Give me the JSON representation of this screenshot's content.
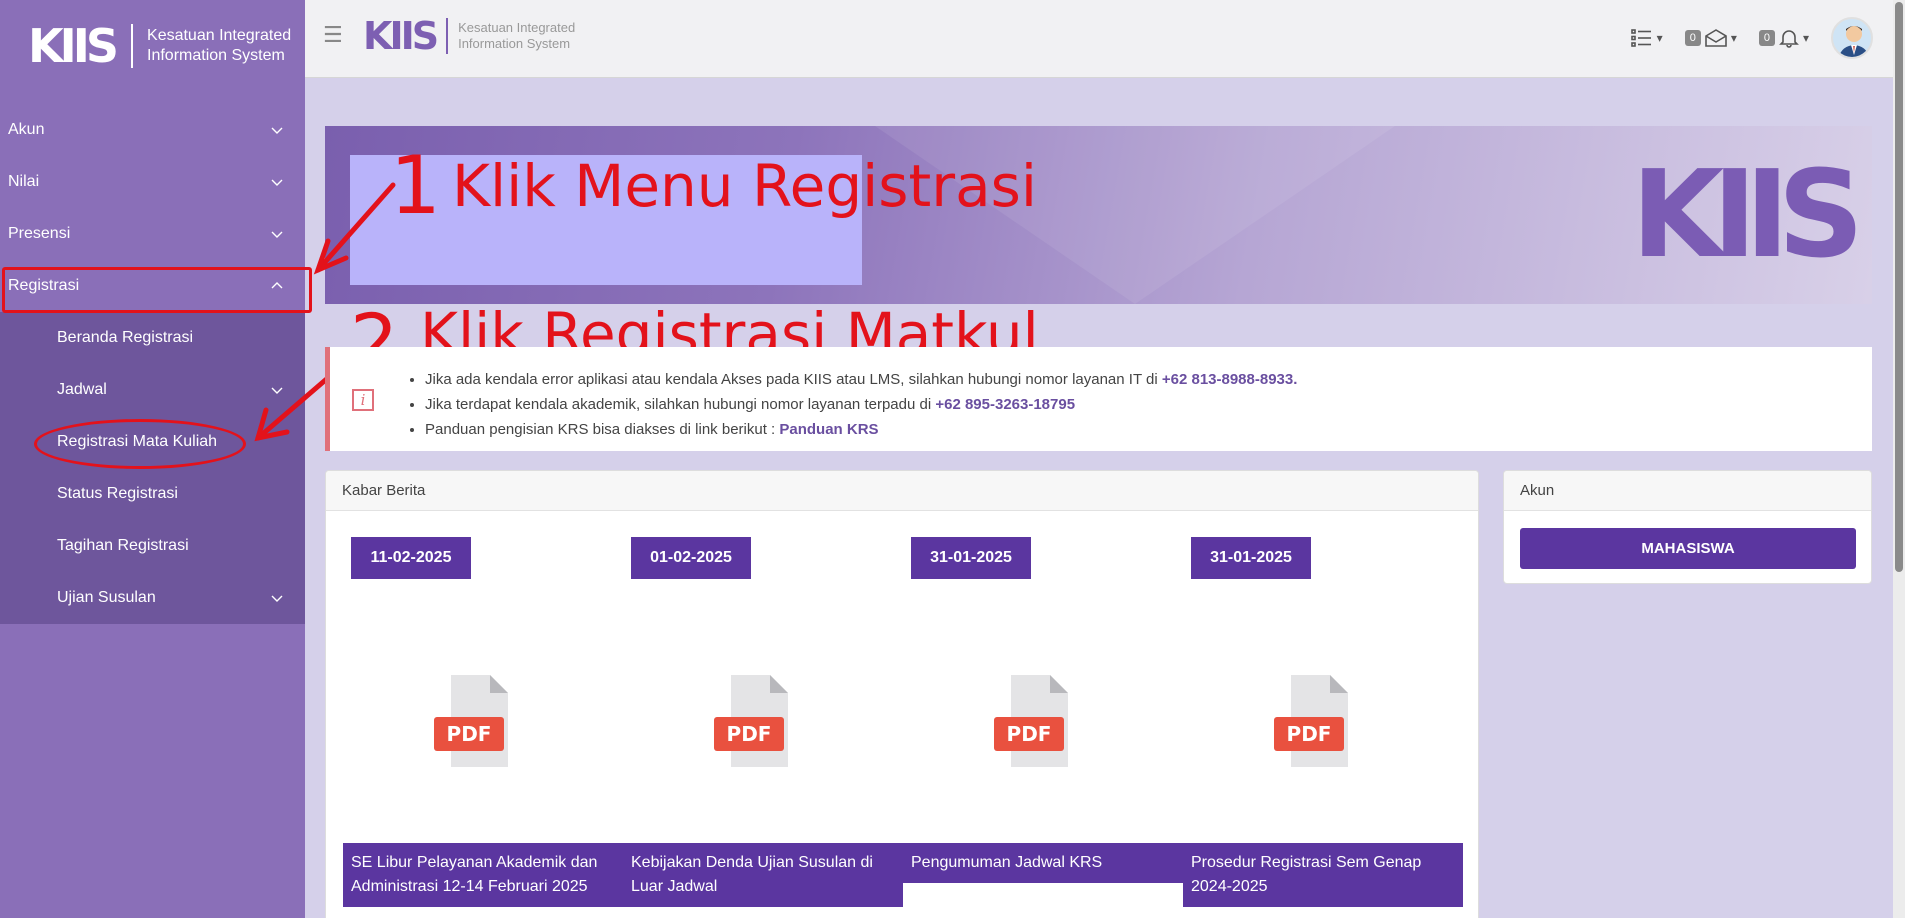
{
  "sidebar": {
    "brand_logo": "KIIS",
    "brand_line1": "Kesatuan Integrated",
    "brand_line2": "Information System",
    "items": [
      {
        "label": "Akun"
      },
      {
        "label": "Nilai"
      },
      {
        "label": "Presensi"
      },
      {
        "label": "Registrasi"
      }
    ],
    "subitems": [
      {
        "label": "Beranda Registrasi"
      },
      {
        "label": "Jadwal"
      },
      {
        "label": "Registrasi Mata Kuliah"
      },
      {
        "label": "Status Registrasi"
      },
      {
        "label": "Tagihan Registrasi"
      },
      {
        "label": "Ujian Susulan"
      }
    ]
  },
  "topbar": {
    "logo": "KIIS",
    "line1": "Kesatuan Integrated",
    "line2": "Information System",
    "mail_count": "0",
    "notif_count": "0"
  },
  "annotations": {
    "step1_num": "1",
    "step1_text": "Klik Menu Registrasi",
    "step2_num": "2",
    "step2_text": "Klik Registrasi Matkul"
  },
  "info": {
    "line1_text": "Jika ada kendala error aplikasi atau kendala Akses pada KIIS atau LMS, silahkan hubungi nomor layanan IT di ",
    "line1_phone": "+62 813-8988-8933.",
    "line2_text": "Jika terdapat kendala akademik, silahkan hubungi nomor layanan terpadu di ",
    "line2_phone": "+62 895-3263-18795",
    "line3_text": "Panduan pengisian KRS bisa diakses di link berikut : ",
    "line3_link": "Panduan KRS"
  },
  "news": {
    "header": "Kabar Berita",
    "pdf_label": "PDF",
    "items": [
      {
        "date": "11-02-2025",
        "title": "SE Libur Pelayanan Akademik dan Administrasi 12-14 Februari 2025"
      },
      {
        "date": "01-02-2025",
        "title": "Kebijakan Denda Ujian Susulan di Luar Jadwal"
      },
      {
        "date": "31-01-2025",
        "title": "Pengumuman Jadwal KRS"
      },
      {
        "date": "31-01-2025",
        "title": "Prosedur Registrasi Sem Genap 2024-2025"
      }
    ]
  },
  "akun": {
    "header": "Akun",
    "button": "MAHASISWA"
  },
  "colors": {
    "primary": "#5b36a0",
    "sidebar": "#8a6fb8",
    "annotation": "#e3121b"
  }
}
